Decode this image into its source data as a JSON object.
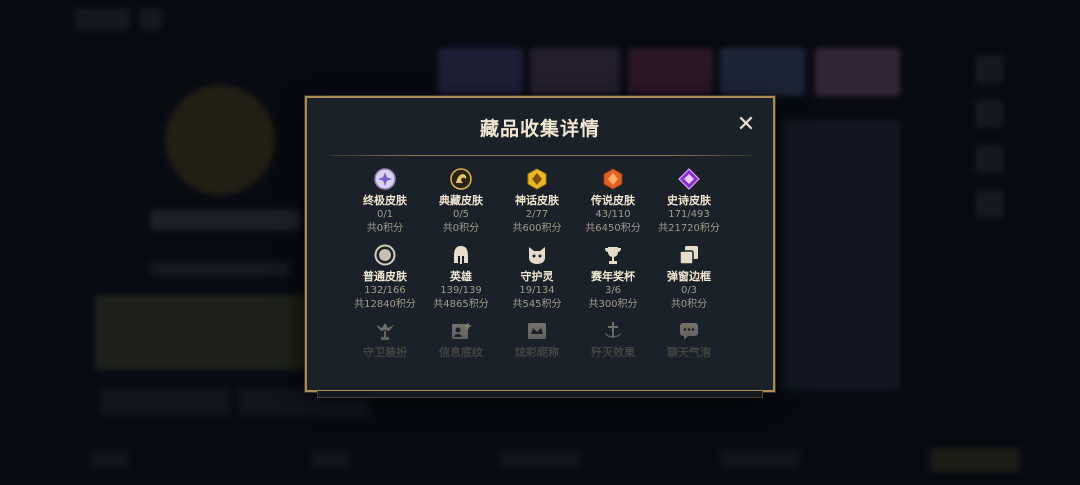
{
  "modal": {
    "title": "藏品收集详情",
    "close_label": "✕"
  },
  "items": [
    {
      "label": "终极皮肤",
      "count": "0/1",
      "points": "共0积分",
      "icon": "ultimate-skin-icon"
    },
    {
      "label": "典藏皮肤",
      "count": "0/5",
      "points": "共0积分",
      "icon": "prestige-skin-icon"
    },
    {
      "label": "神话皮肤",
      "count": "2/77",
      "points": "共600积分",
      "icon": "mythic-skin-icon"
    },
    {
      "label": "传说皮肤",
      "count": "43/110",
      "points": "共6450积分",
      "icon": "legendary-skin-icon"
    },
    {
      "label": "史诗皮肤",
      "count": "171/493",
      "points": "共21720积分",
      "icon": "epic-skin-icon"
    },
    {
      "label": "普通皮肤",
      "count": "132/166",
      "points": "共12840积分",
      "icon": "standard-skin-icon"
    },
    {
      "label": "英雄",
      "count": "139/139",
      "points": "共4865积分",
      "icon": "champion-helmet-icon"
    },
    {
      "label": "守护灵",
      "count": "19/134",
      "points": "共545积分",
      "icon": "guardian-cat-icon"
    },
    {
      "label": "赛年奖杯",
      "count": "3/6",
      "points": "共300积分",
      "icon": "season-trophy-icon"
    },
    {
      "label": "弹窗边框",
      "count": "0/3",
      "points": "共0积分",
      "icon": "popup-frame-icon"
    },
    {
      "label": "守卫装扮",
      "icon": "ward-skin-icon"
    },
    {
      "label": "信息底纹",
      "icon": "profile-banner-icon"
    },
    {
      "label": "炫彩昵称",
      "icon": "colorful-nickname-icon"
    },
    {
      "label": "歼灭效果",
      "icon": "elimination-effect-icon"
    },
    {
      "label": "聊天气泡",
      "icon": "chat-bubble-icon"
    }
  ]
}
